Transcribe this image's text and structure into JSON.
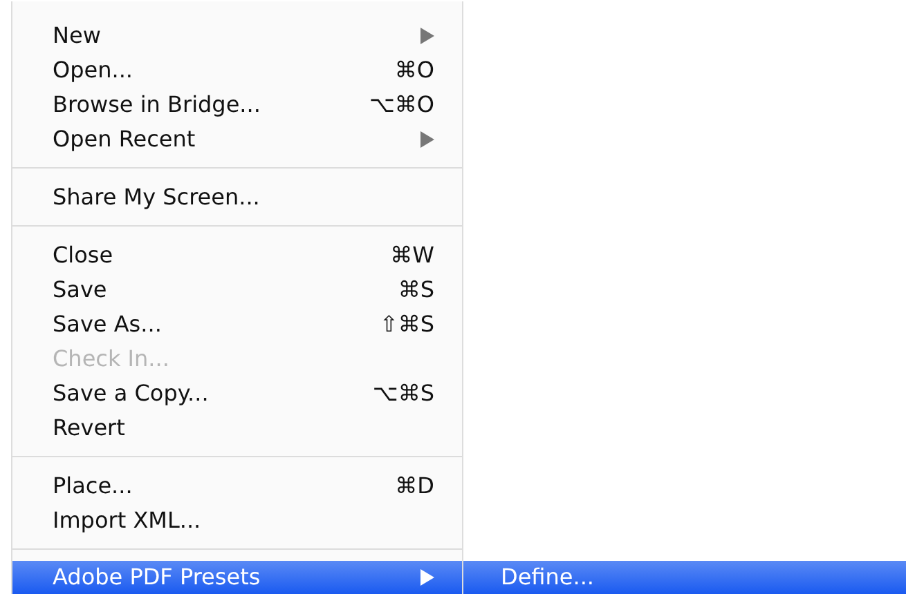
{
  "menu": {
    "items": [
      {
        "kind": "item",
        "label": "New",
        "submenu": true,
        "disabled": false,
        "selected": false
      },
      {
        "kind": "item",
        "label": "Open...",
        "shortcut": "⌘O",
        "disabled": false,
        "selected": false
      },
      {
        "kind": "item",
        "label": "Browse in Bridge...",
        "shortcut": "⌥⌘O",
        "disabled": false,
        "selected": false
      },
      {
        "kind": "item",
        "label": "Open Recent",
        "submenu": true,
        "disabled": false,
        "selected": false
      },
      {
        "kind": "separator"
      },
      {
        "kind": "item",
        "label": "Share My Screen...",
        "disabled": false,
        "selected": false
      },
      {
        "kind": "separator"
      },
      {
        "kind": "item",
        "label": "Close",
        "shortcut": "⌘W",
        "disabled": false,
        "selected": false
      },
      {
        "kind": "item",
        "label": "Save",
        "shortcut": "⌘S",
        "disabled": false,
        "selected": false
      },
      {
        "kind": "item",
        "label": "Save As...",
        "shortcut": "⇧⌘S",
        "disabled": false,
        "selected": false
      },
      {
        "kind": "item",
        "label": "Check In...",
        "disabled": true,
        "selected": false
      },
      {
        "kind": "item",
        "label": "Save a Copy...",
        "shortcut": "⌥⌘S",
        "disabled": false,
        "selected": false
      },
      {
        "kind": "item",
        "label": "Revert",
        "disabled": false,
        "selected": false
      },
      {
        "kind": "separator"
      },
      {
        "kind": "item",
        "label": "Place...",
        "shortcut": "⌘D",
        "disabled": false,
        "selected": false
      },
      {
        "kind": "item",
        "label": "Import XML...",
        "disabled": false,
        "selected": false
      },
      {
        "kind": "separator"
      },
      {
        "kind": "item",
        "label": "Adobe PDF Presets",
        "submenu": true,
        "disabled": false,
        "selected": true
      }
    ]
  },
  "submenu": {
    "items": [
      {
        "kind": "item",
        "label": "Define...",
        "disabled": false,
        "selected": true
      }
    ]
  }
}
